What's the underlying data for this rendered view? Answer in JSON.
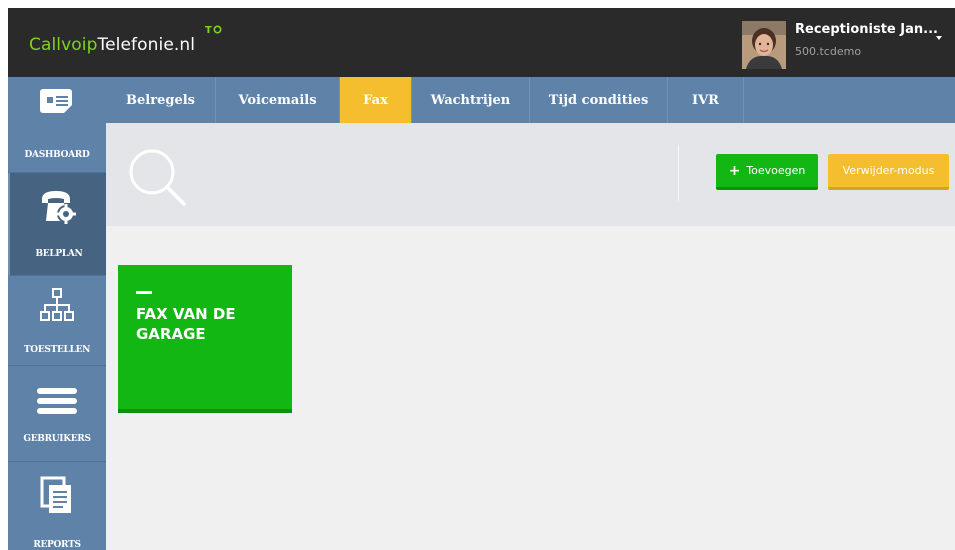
{
  "app": {
    "logo_part1": "Callvoip",
    "logo_part2": "Telefonie.nl",
    "logo_mark": "T"
  },
  "user": {
    "name": "Receptioniste Jan...",
    "account": "500.tcdemo",
    "caret": "˯"
  },
  "sidebar": {
    "items": [
      {
        "label": "DASHBOARD",
        "icon": "dashboard-icon"
      },
      {
        "label": "BELPLAN",
        "icon": "phone-settings-icon",
        "active": true
      },
      {
        "label": "TOESTELLEN",
        "icon": "network-tree-icon"
      },
      {
        "label": "GEBRUIKERS",
        "icon": "menu-lines-icon"
      },
      {
        "label": "REPORTS",
        "icon": "documents-icon"
      }
    ]
  },
  "tabs": [
    {
      "label": "Belregels"
    },
    {
      "label": "Voicemails"
    },
    {
      "label": "Fax",
      "active": true
    },
    {
      "label": "Wachtrijen"
    },
    {
      "label": "Tijd condities"
    },
    {
      "label": "IVR"
    }
  ],
  "toolbar": {
    "add_label": "Toevoegen",
    "delete_mode_label": "Verwijder-modus"
  },
  "cards": [
    {
      "title": "FAX VAN DE GARAGE"
    }
  ],
  "colors": {
    "accent_green": "#13b713",
    "accent_yellow": "#f4be2e",
    "nav_blue": "#5f83a8",
    "nav_active": "#466481",
    "topbar": "#2a2a2a"
  }
}
